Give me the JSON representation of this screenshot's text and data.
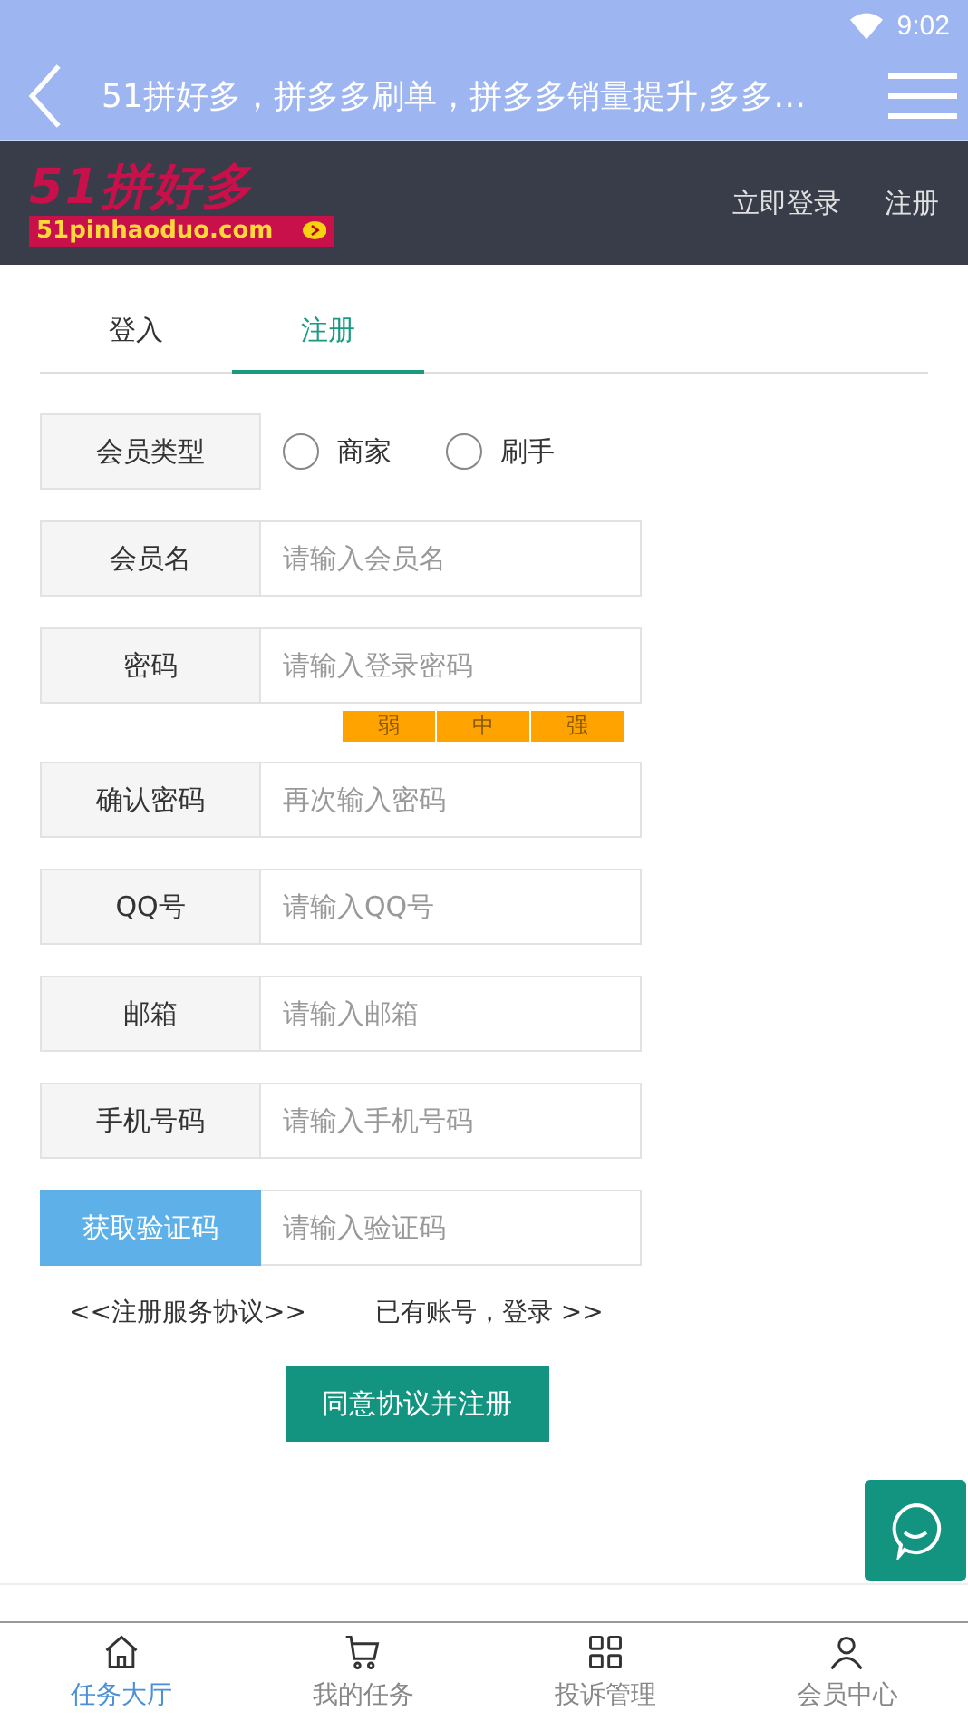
{
  "status_bar": {
    "time": "9:02"
  },
  "title_bar": {
    "title": "51拼好多，拼多多刷单，拼多多销量提升,多多…"
  },
  "header": {
    "logo_text": "51拼好多",
    "logo_domain": "51pinhaoduo.com",
    "links": [
      "立即登录",
      "注册"
    ]
  },
  "tabs": [
    {
      "label": "登入",
      "selected": false
    },
    {
      "label": "注册",
      "selected": true
    }
  ],
  "form": [
    {
      "kind": "radio",
      "label": "会员类型",
      "options": [
        {
          "label": "商家",
          "selected": false
        },
        {
          "label": "刷手",
          "selected": false
        }
      ]
    },
    {
      "kind": "input",
      "label": "会员名",
      "placeholder": "请输入会员名"
    },
    {
      "kind": "input",
      "label": "密码",
      "placeholder": "请输入登录密码",
      "strength": [
        "弱",
        "中",
        "强"
      ]
    },
    {
      "kind": "input",
      "label": "确认密码",
      "placeholder": "再次输入密码"
    },
    {
      "kind": "input",
      "label": "QQ号",
      "placeholder": "请输入QQ号"
    },
    {
      "kind": "input",
      "label": "邮箱",
      "placeholder": "请输入邮箱"
    },
    {
      "kind": "input",
      "label": "手机号码",
      "placeholder": "请输入手机号码"
    },
    {
      "kind": "code",
      "label": "获取验证码",
      "placeholder": "请输入验证码"
    }
  ],
  "links": [
    "<<注册服务协议>>",
    "已有账号，登录 >>"
  ],
  "submit": "同意协议并注册",
  "bottom_nav": [
    {
      "kind": "home",
      "label": "任务大厅",
      "selected": true
    },
    {
      "kind": "cart",
      "label": "我的任务",
      "selected": false
    },
    {
      "kind": "grid",
      "label": "投诉管理",
      "selected": false
    },
    {
      "kind": "user",
      "label": "会员中心",
      "selected": false
    }
  ]
}
